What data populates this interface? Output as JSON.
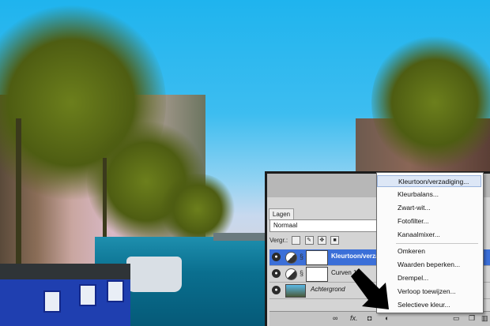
{
  "panel": {
    "tab_label": "Lagen",
    "blend_mode": "Normaal",
    "lock_label": "Vergr.:",
    "layers": [
      {
        "name": "Kleurtoon/verzadiging 1",
        "selected": true
      },
      {
        "name": "Curven 1",
        "selected": false
      },
      {
        "name": "Achtergrond",
        "selected": false
      }
    ],
    "bottom_icons": [
      "link-icon",
      "fx-icon",
      "mask-icon",
      "adjustment-icon",
      "folder-icon",
      "new-layer-icon",
      "trash-icon"
    ],
    "fx_label": "fx."
  },
  "menu": {
    "items": [
      "Kleurtoon/verzadiging...",
      "Kleurbalans...",
      "Zwart-wit...",
      "Fotofilter...",
      "Kanaalmixer...",
      "Omkeren",
      "Waarden beperken...",
      "Drempel...",
      "Verloop toewijzen...",
      "Selectieve kleur..."
    ],
    "highlighted_index": 0
  },
  "colors": {
    "selection": "#3b6fd8",
    "menu_highlight": "#dde7f6",
    "panel_bg": "#d4d4d4"
  }
}
